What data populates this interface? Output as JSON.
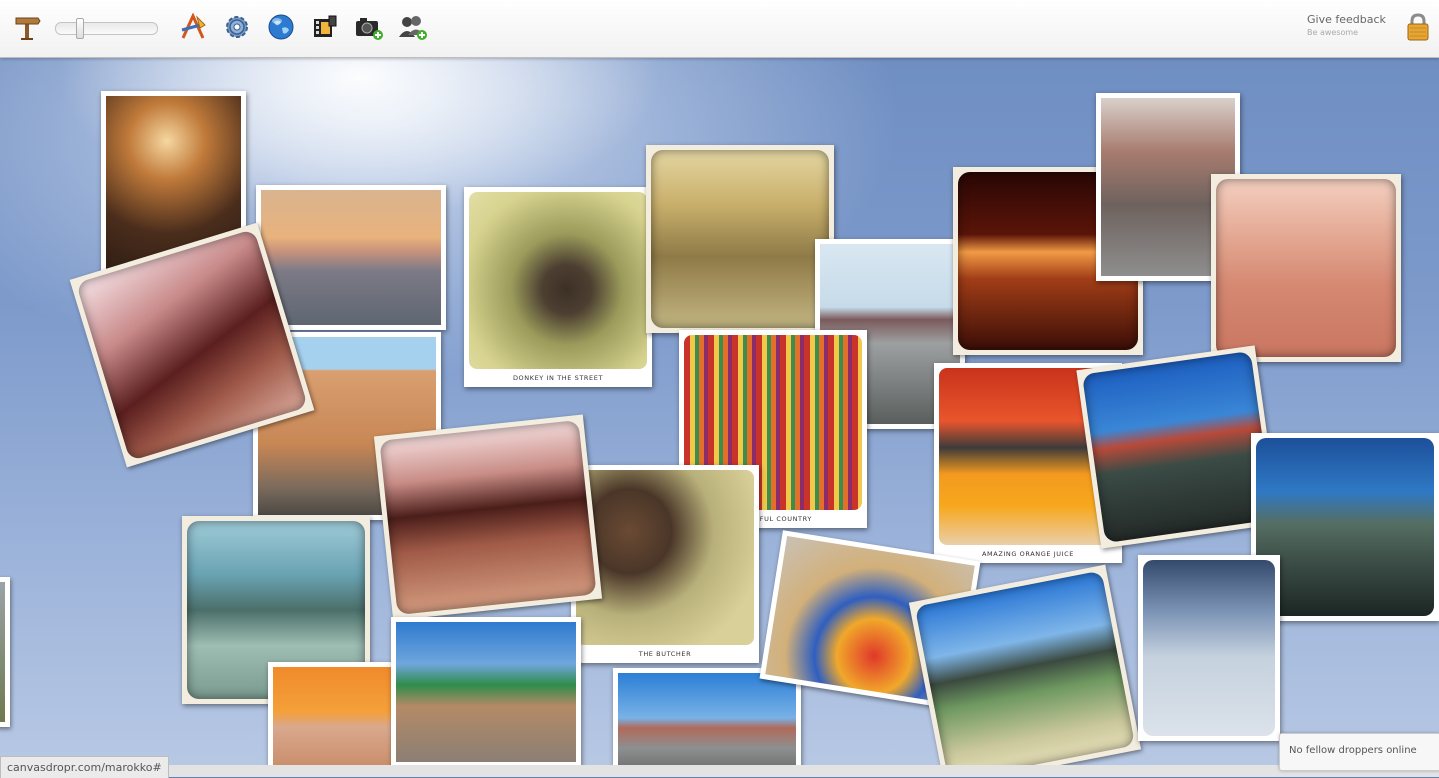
{
  "toolbar": {
    "icons": [
      "signpost-icon",
      "drawing-tools-icon",
      "gear-icon",
      "globe-icon",
      "film-icon",
      "camera-add-icon",
      "users-add-icon"
    ],
    "feedback_title": "Give feedback",
    "feedback_subtitle": "Be awesome"
  },
  "photos": {
    "donkey_caption": "DONKEY IN THE STREET",
    "colorful_caption": "COLORFUL COUNTRY",
    "juice_caption": "AMAZING ORANGE JUICE",
    "butcher_caption": "THE BUTCHER"
  },
  "status": {
    "url": "canvasdropr.com/marokko#",
    "online": "No fellow droppers online"
  },
  "colors": {
    "toolbar_bg": "#f5f5f5",
    "sky": "#7d9acb",
    "accent": "#1f5fb0"
  }
}
